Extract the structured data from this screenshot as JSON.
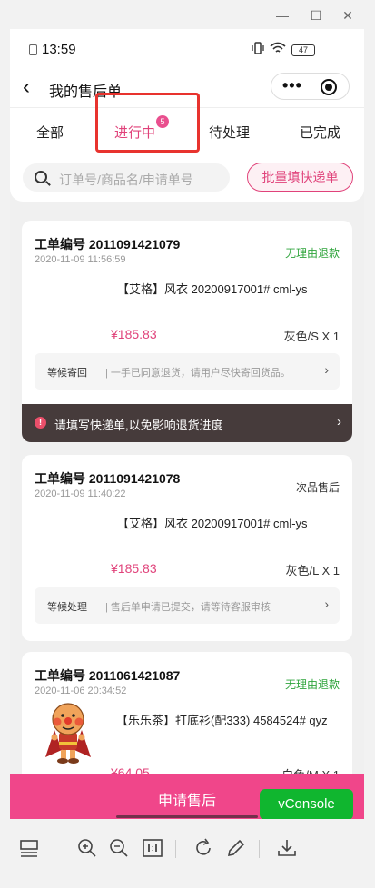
{
  "window": {
    "minimize_glyph": "—",
    "maximize_glyph": "☐",
    "close_glyph": "✕"
  },
  "status": {
    "time": "13:59",
    "battery": "47"
  },
  "nav": {
    "title": "我的售后单",
    "back_glyph": "‹",
    "more_glyph": "•••"
  },
  "tabs": [
    {
      "label": "全部"
    },
    {
      "label": "进行中",
      "badge": "5"
    },
    {
      "label": "待处理"
    },
    {
      "label": "已完成"
    }
  ],
  "search": {
    "placeholder": "订单号/商品名/申请单号",
    "batch_label": "批量填快递单"
  },
  "orders": [
    {
      "work_order": "工单编号 2011091421079",
      "date": "2020-11-09 11:56:59",
      "status": "无理由退款",
      "product": "【艾格】风衣 20200917001# cml-ys",
      "price": "¥185.83",
      "spec": "灰色/S X 1",
      "progress_label": "等候寄回",
      "progress_desc": "一手已同意退货，请用户尽快寄回货品。"
    },
    {
      "work_order": "工单编号 2011091421078",
      "date": "2020-11-09 11:40:22",
      "status": "次品售后",
      "product": "【艾格】风衣 20200917001# cml-ys",
      "price": "¥185.83",
      "spec": "灰色/L X 1",
      "progress_label": "等候处理",
      "progress_desc": "售后单申请已提交，请等待客服审核"
    },
    {
      "work_order": "工单编号 2011061421087",
      "date": "2020-11-06 20:34:52",
      "status": "无理由退款",
      "product": "【乐乐茶】打底衫(配333) 4584524# qyz",
      "price": "¥64.05",
      "spec": "白色/M X 1"
    }
  ],
  "warning": {
    "text": "请填写快递单,以免影响退货进度",
    "icon_glyph": "!"
  },
  "bottom": {
    "apply_label": "申请售后"
  },
  "vconsole": {
    "label": "vConsole"
  },
  "arrow_glyph": "›",
  "colors": {
    "accent": "#e0427a",
    "green": "#2fa43c",
    "vconsole": "#10b62f",
    "warning_bg": "#463b3b"
  }
}
